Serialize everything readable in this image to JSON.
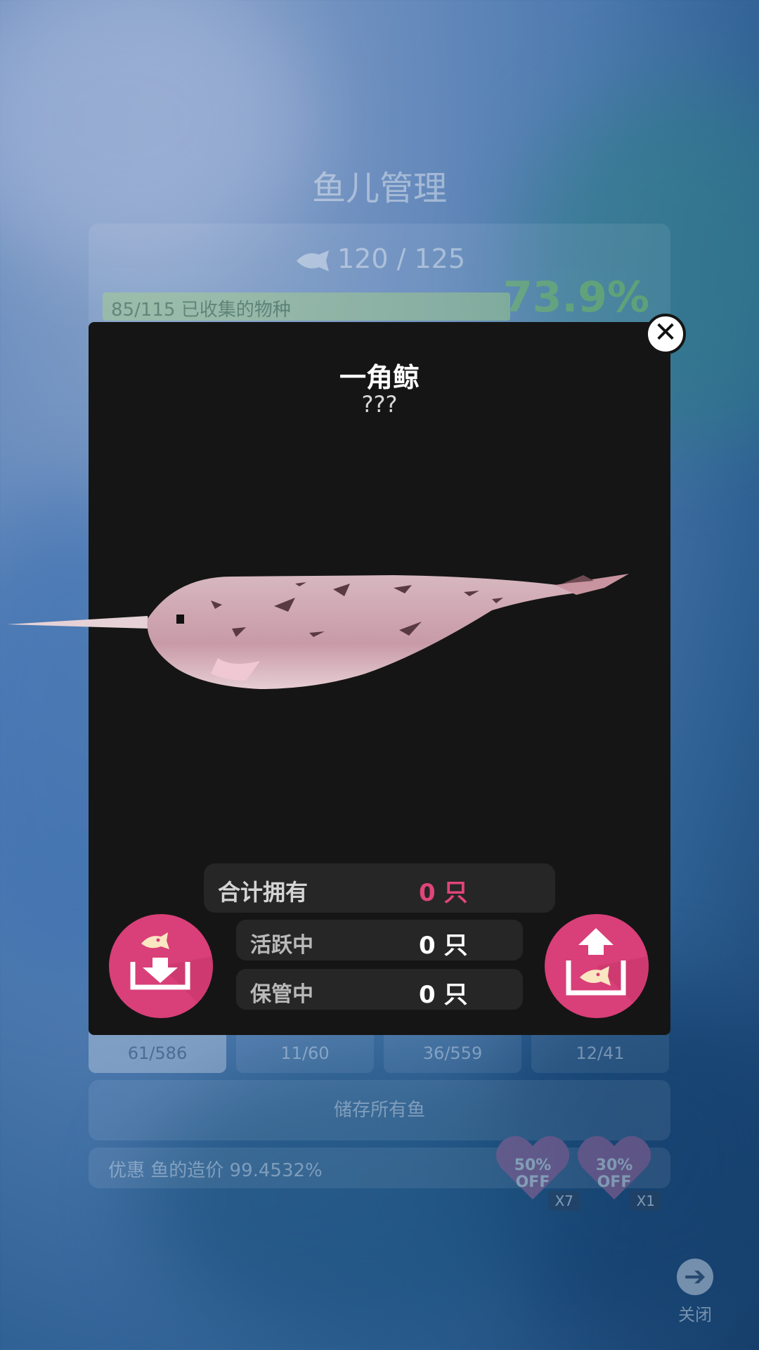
{
  "background": {
    "title": "鱼儿管理",
    "fish_count": "120 / 125",
    "collection_progress": {
      "label": "85/115 已收集的物种",
      "fraction": 0.739
    },
    "collection_percent": "73.9%",
    "tabs": [
      {
        "value": "61/586",
        "active": true
      },
      {
        "value": "11/60",
        "active": false
      },
      {
        "value": "36/559",
        "active": false
      },
      {
        "value": "12/41",
        "active": false
      }
    ],
    "store_all_label": "储存所有鱼",
    "discount_text": "优惠 鱼的造价 99.4532%",
    "coupons": [
      {
        "label_top": "50%",
        "label_bottom": "OFF",
        "count": "X7"
      },
      {
        "label_top": "30%",
        "label_bottom": "OFF",
        "count": "X1"
      }
    ],
    "close_label": "关闭"
  },
  "modal": {
    "fish_name": "一角鲸",
    "fish_subtitle": "???",
    "total": {
      "label": "合计拥有",
      "value": "0 只"
    },
    "active": {
      "label": "活跃中",
      "value": "0 只"
    },
    "stored": {
      "label": "保管中",
      "value": "0 只"
    }
  },
  "colors": {
    "accent_pink": "#d93f78",
    "modal_bg": "#151515",
    "progress_green": "#b8e08a"
  }
}
